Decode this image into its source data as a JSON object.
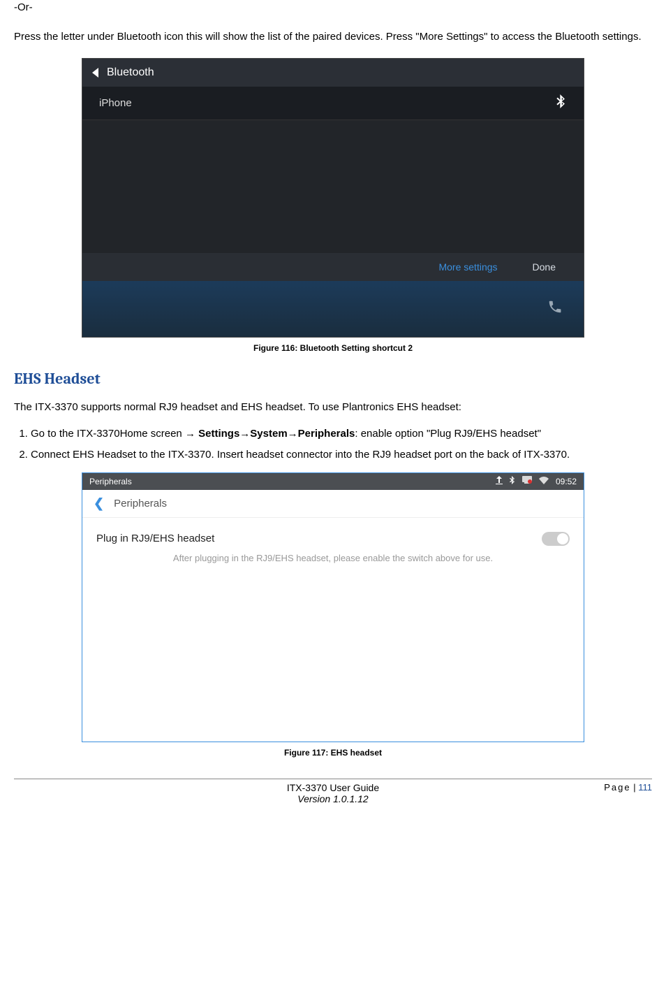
{
  "intro": {
    "or": "-Or-",
    "desc": "Press the letter under Bluetooth icon this will show the list of the paired devices. Press \"More Settings\" to access the Bluetooth settings."
  },
  "fig116": {
    "header": "Bluetooth",
    "device": "iPhone",
    "more": "More settings",
    "done": "Done",
    "caption": "Figure 116: Bluetooth Setting shortcut 2"
  },
  "section": {
    "title": "EHS Headset",
    "intro": "The ITX-3370 supports normal RJ9 headset and EHS headset. To use Plantronics EHS headset:",
    "step1a": "Go to the ITX-3370Home screen →",
    "step1b": "Settings→System→Peripherals",
    "step1c": ": enable option \"Plug RJ9/EHS headset\"",
    "step2": "Connect EHS Headset to the ITX-3370. Insert headset connector into the RJ9 headset port on the back of ITX-3370."
  },
  "fig117": {
    "toplabel": "Peripherals",
    "time": "09:52",
    "navlabel": "Peripherals",
    "rowlabel": "Plug in RJ9/EHS headset",
    "sub": "After plugging in the RJ9/EHS headset, please enable the switch above for use.",
    "caption": "Figure 117: EHS headset"
  },
  "footer": {
    "page_label": "Page",
    "sep": " | ",
    "page_num": "111",
    "line1": "ITX-3370 User Guide",
    "line2": "Version 1.0.1.12"
  }
}
